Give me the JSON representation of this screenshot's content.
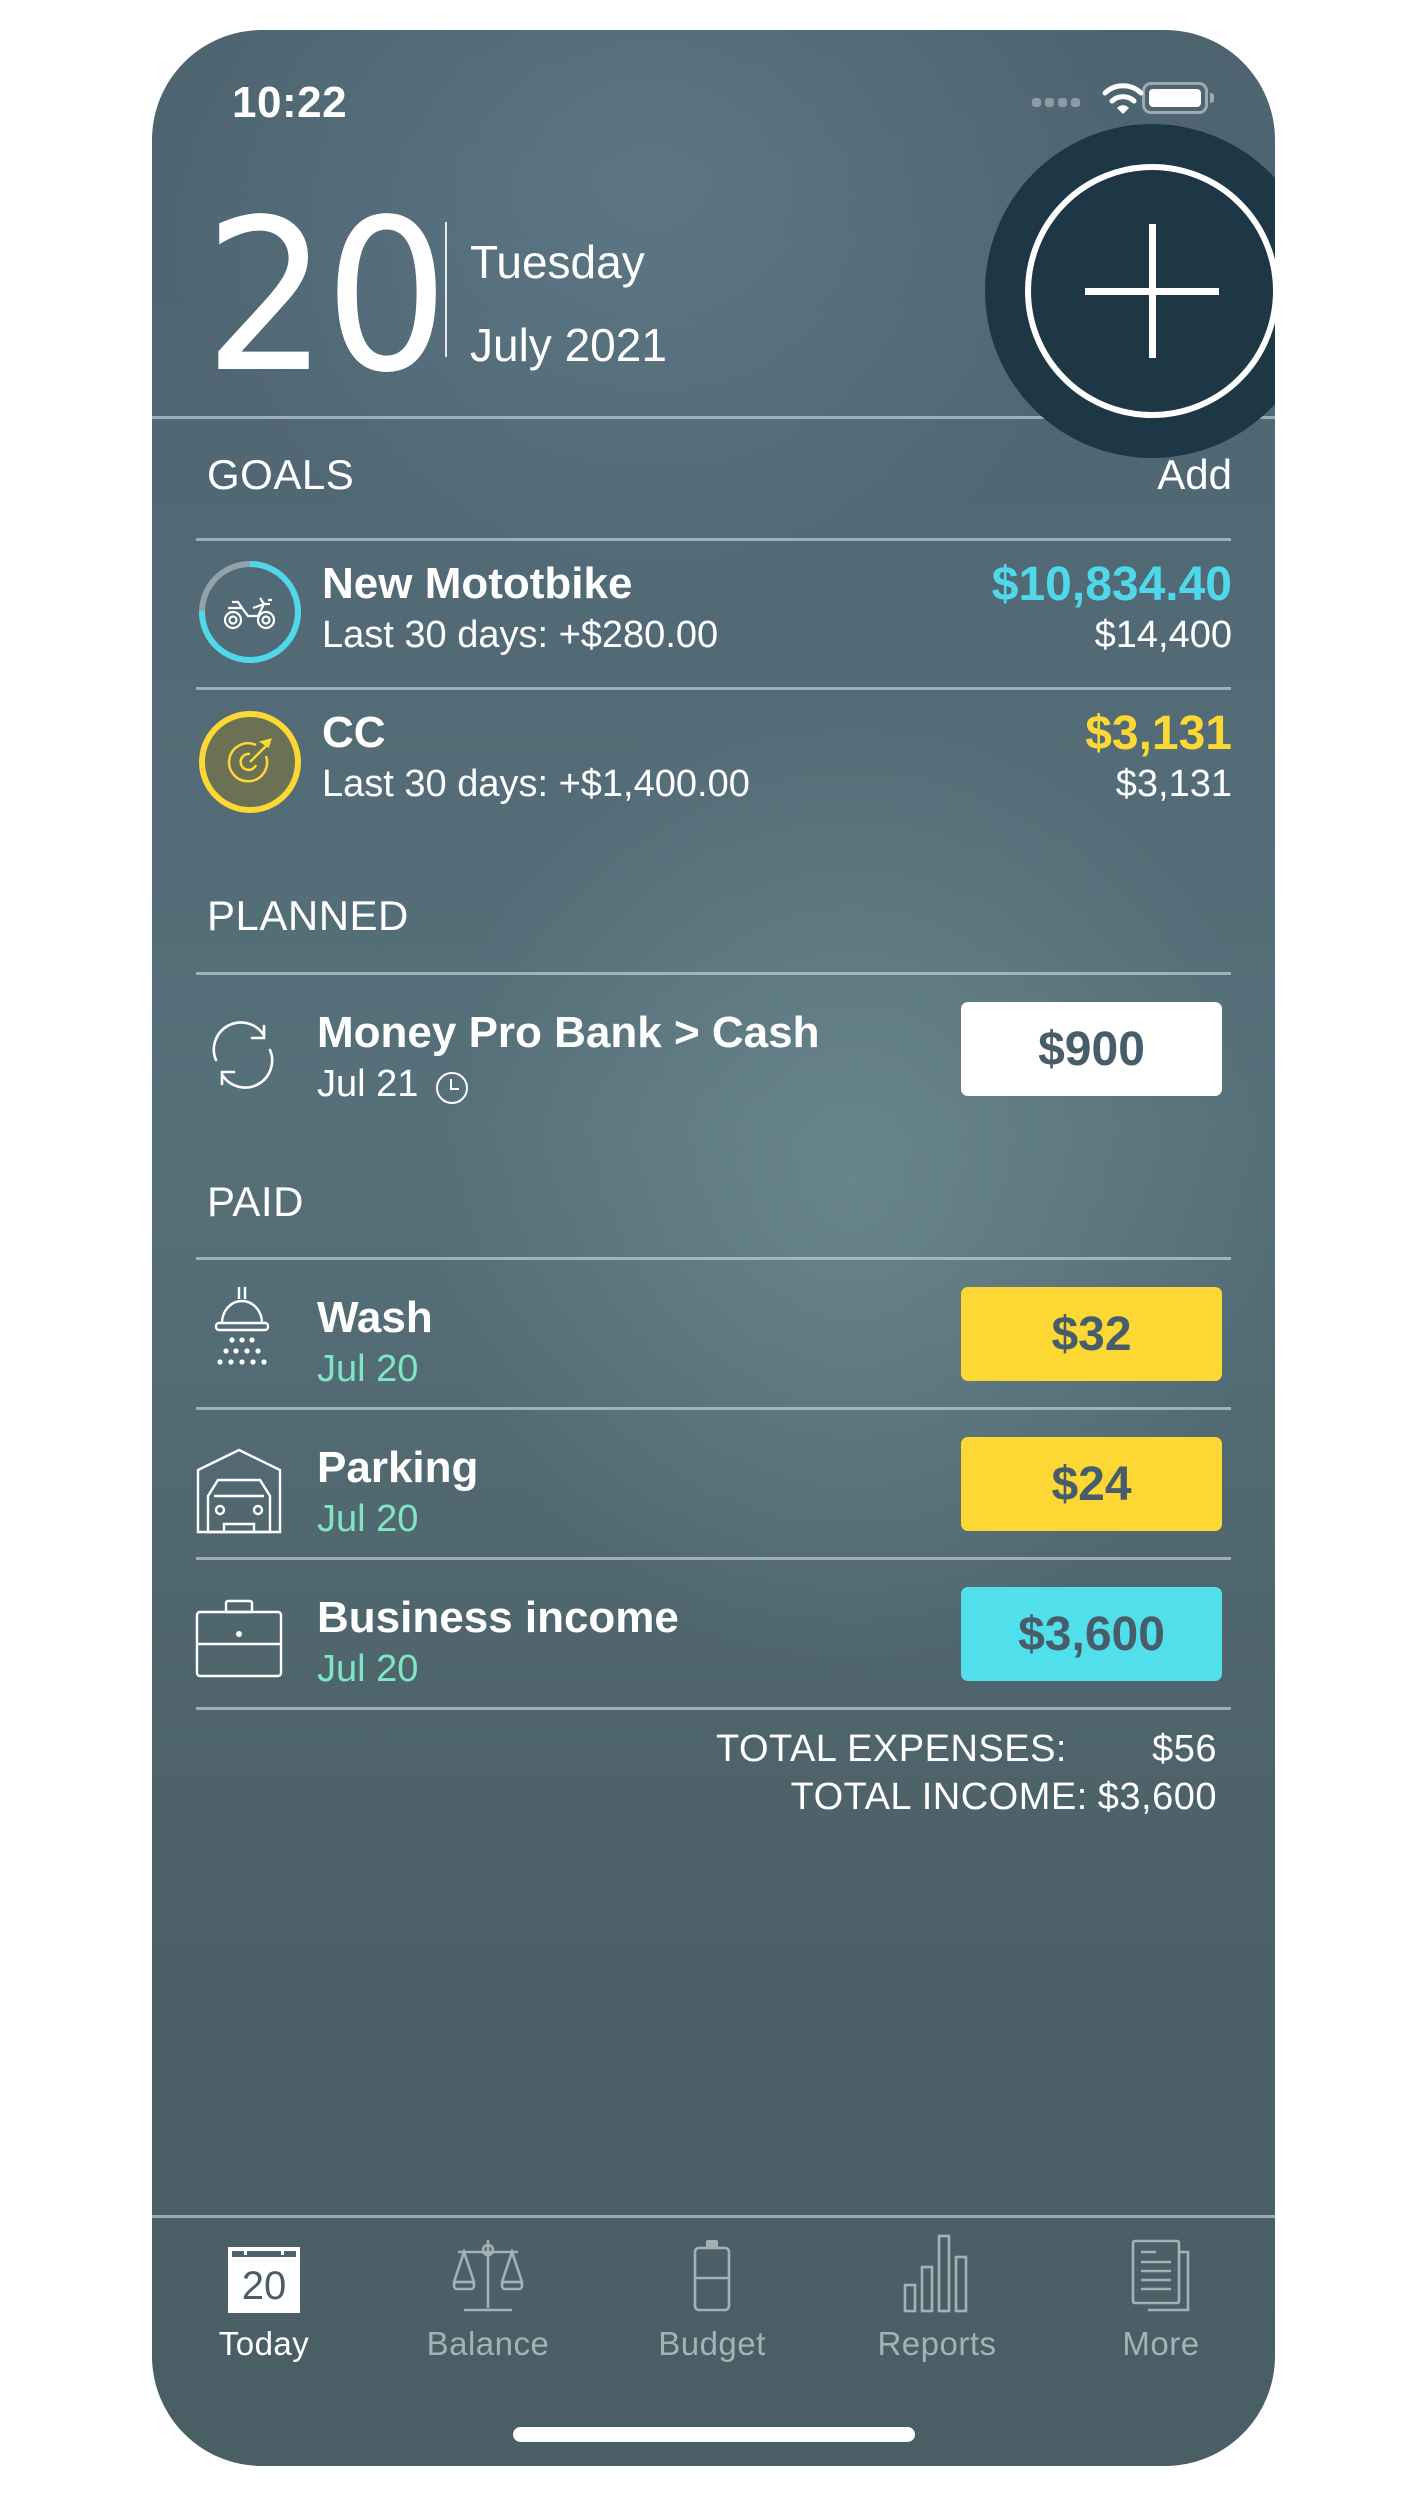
{
  "status_bar": {
    "time": "10:22",
    "wifi_icon": "wifi-icon",
    "battery_icon": "battery-icon",
    "signal_icon": "signal-dots-icon"
  },
  "header": {
    "day": "20",
    "weekday": "Tuesday",
    "month_year": "July 2021",
    "add_button_icon": "plus-icon"
  },
  "goals": {
    "title": "GOALS",
    "add_label": "Add",
    "items": [
      {
        "name": "New Mototbike",
        "sub": "Last 30 days: +$280.00",
        "saved": "$10,834.40",
        "target": "$14,400",
        "progress": 0.752,
        "color": "#4fd8ea",
        "icon": "motorbike-icon"
      },
      {
        "name": "CC",
        "sub": "Last 30 days: +$1,400.00",
        "saved": "$3,131",
        "target": "$3,131",
        "progress": 1.0,
        "color": "#fdd835",
        "icon": "target-icon"
      }
    ]
  },
  "planned": {
    "title": "PLANNED",
    "items": [
      {
        "name": "Money Pro Bank > Cash",
        "date": "Jul 21",
        "amount": "$900",
        "icon": "recurring-transfer-icon",
        "status_icon": "clock-icon",
        "box_color": "#ffffff"
      }
    ]
  },
  "paid": {
    "title": "PAID",
    "items": [
      {
        "name": "Wash",
        "date": "Jul 20",
        "amount": "$32",
        "icon": "shower-icon",
        "box_color": "#fdd835"
      },
      {
        "name": "Parking",
        "date": "Jul 20",
        "amount": "$24",
        "icon": "garage-car-icon",
        "box_color": "#fdd835"
      },
      {
        "name": "Business income",
        "date": "Jul 20",
        "amount": "$3,600",
        "icon": "briefcase-icon",
        "box_color": "#52dfec"
      }
    ]
  },
  "totals": {
    "expenses_label": "TOTAL EXPENSES:",
    "expenses_value": "$56",
    "income_label": "TOTAL INCOME:",
    "income_value": "$3,600"
  },
  "tab_bar": {
    "active": "Today",
    "tabs": [
      {
        "label": "Today",
        "icon": "calendar-day-icon",
        "icon_text": "20"
      },
      {
        "label": "Balance",
        "icon": "scales-icon"
      },
      {
        "label": "Budget",
        "icon": "battery-jar-icon"
      },
      {
        "label": "Reports",
        "icon": "bar-chart-icon"
      },
      {
        "label": "More",
        "icon": "documents-icon"
      }
    ]
  },
  "colors": {
    "goal_blue": "#4fd8ea",
    "goal_yellow": "#fdd835",
    "paid_date": "#7fe6c2",
    "add_button": "#1d3745"
  }
}
